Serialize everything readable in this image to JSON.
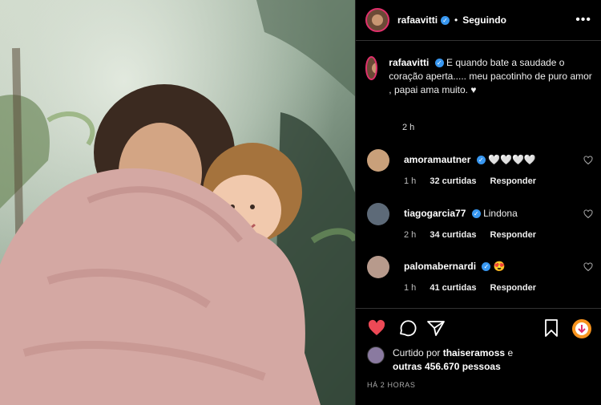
{
  "post": {
    "username": "rafaavitti",
    "follow_status": "Seguindo",
    "caption": "E quando bate a saudade o coração aperta..... meu pacotinho de puro amor , papai ama muito. ♥",
    "caption_time": "2 h",
    "comments": [
      {
        "user": "amoramautner",
        "text": "🤍🤍🤍🤍",
        "time": "1 h",
        "likes": "32 curtidas",
        "reply": "Responder"
      },
      {
        "user": "tiagogarcia77",
        "text": "Lindona",
        "time": "2 h",
        "likes": "34 curtidas",
        "reply": "Responder"
      },
      {
        "user": "palomabernardi",
        "text": "😍",
        "time": "1 h",
        "likes": "41 curtidas",
        "reply": "Responder"
      }
    ],
    "liked_by_prefix": "Curtido por",
    "liked_by_user": "thaiseramoss",
    "liked_by_conj": "e",
    "liked_by_others": "outras 456.670 pessoas",
    "posted_ago": "HÁ 2 HORAS"
  },
  "colors": {
    "like_red": "#ed4956",
    "verified_blue": "#3897f0",
    "story_ring": "#e1306c"
  },
  "icons": [
    "heart-icon",
    "comment-icon",
    "share-icon",
    "bookmark-icon",
    "more-icon",
    "verified-icon",
    "gift-icon"
  ]
}
